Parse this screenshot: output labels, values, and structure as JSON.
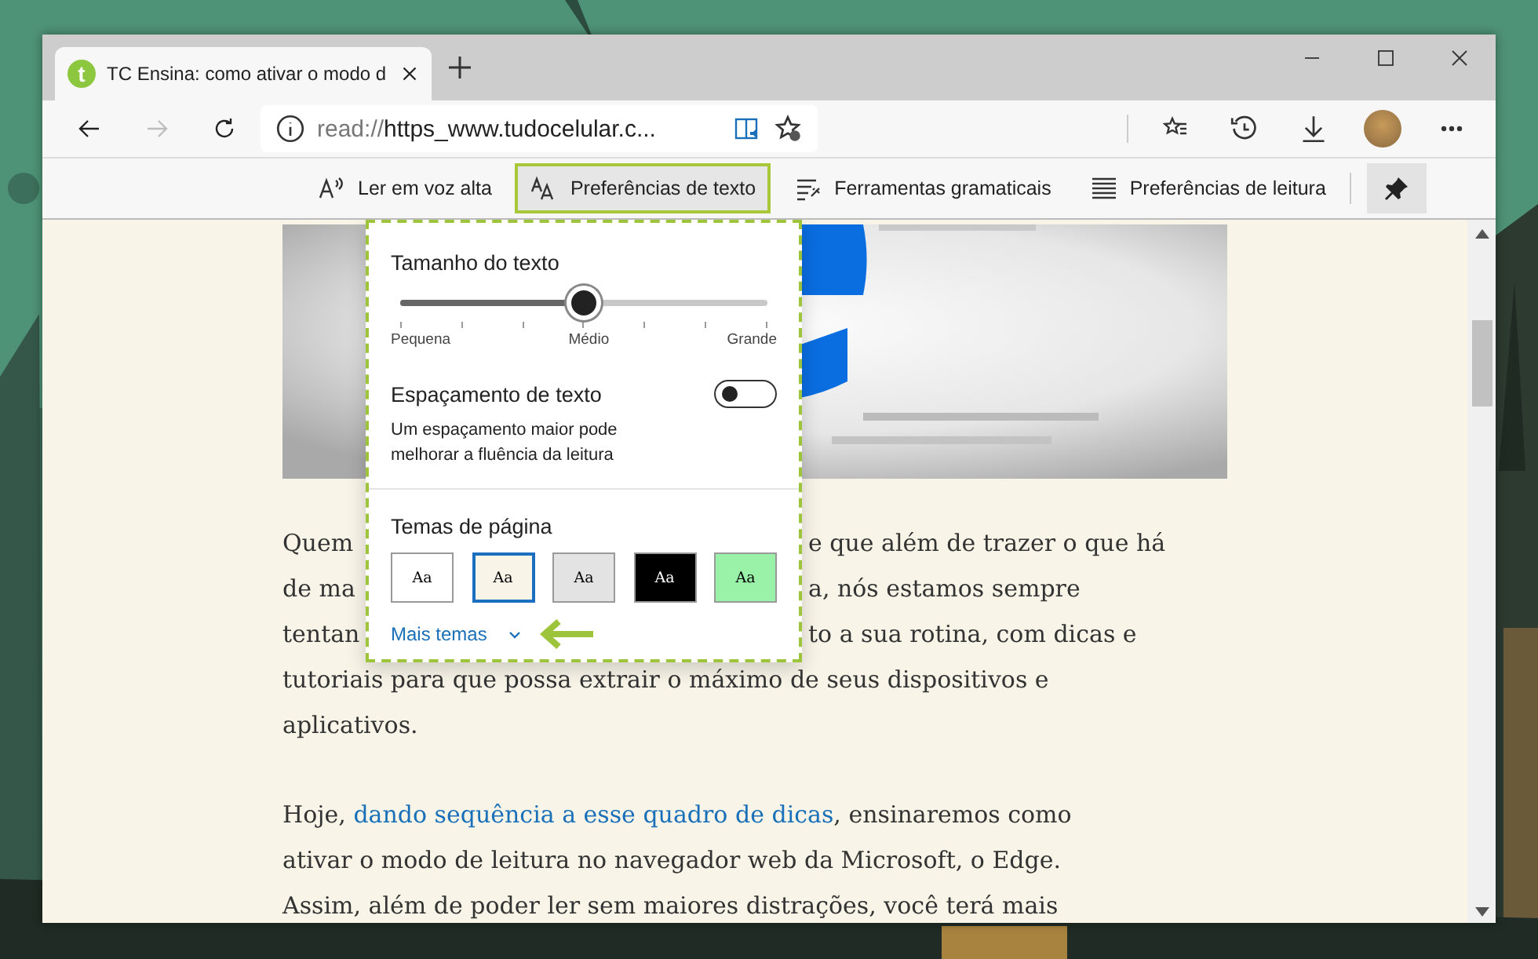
{
  "tabs": [
    {
      "favicon": "t",
      "title": "TC Ensina: como ativar o modo d",
      "selected": true
    }
  ],
  "nav": [
    {
      "kind": "back",
      "disabled": false
    },
    {
      "kind": "forward",
      "disabled": true
    },
    {
      "kind": "refresh",
      "disabled": false
    }
  ],
  "address": {
    "scheme": "read://",
    "rest": "https_www.tudocelular.c..."
  },
  "reader_toolbar": [
    {
      "kind": "read_aloud",
      "label": "Ler em voz alta",
      "selected": false
    },
    {
      "kind": "text_prefs",
      "label": "Preferências de texto",
      "selected": true
    },
    {
      "kind": "grammar",
      "label": "Ferramentas gramaticais",
      "selected": false
    },
    {
      "kind": "reading_prefs",
      "label": "Preferências de leitura",
      "selected": false
    }
  ],
  "text_panel": {
    "size_title": "Tamanho do texto",
    "size": {
      "level": 0.5,
      "labels": [
        "Pequena",
        "Médio",
        "Grande"
      ]
    },
    "spacing_title": "Espaçamento de texto",
    "spacing_on": false,
    "spacing_description": "Um espaçamento maior pode melhorar a fluência da leitura",
    "themes_title": "Temas de página",
    "themes": [
      {
        "label": "Aa",
        "color": "#ffffff",
        "selected": false
      },
      {
        "label": "Aa",
        "color": "#f8f4e8",
        "selected": true
      },
      {
        "label": "Aa",
        "color": "#e3e3e3",
        "selected": false
      },
      {
        "label": "Aa",
        "color": "#000000",
        "selected": false
      },
      {
        "label": "Aa",
        "color": "#99f2a7",
        "selected": false
      }
    ],
    "more_themes": "Mais temas"
  },
  "article": {
    "lines": [
      {
        "left": "Quem",
        "right": "e que além de trazer o que há"
      },
      {
        "left": "de ma",
        "right": "a, nós estamos sempre"
      },
      {
        "left": "tentan",
        "right": "to a sua rotina, com dicas e"
      },
      {
        "left": "tutoriais para que possa extrair o máximo de seus dispositivos e"
      },
      {
        "left": "aplicativos."
      }
    ],
    "paragraph": [
      {
        "kind": "text",
        "text": "Hoje, "
      },
      {
        "kind": "link",
        "text": "dando sequência a esse quadro de dicas"
      },
      {
        "kind": "text",
        "text": ", ensinaremos como"
      },
      {
        "kind": "break"
      },
      {
        "kind": "text",
        "text": "ativar o modo de leitura no navegador web da Microsoft, o Edge."
      },
      {
        "kind": "break"
      },
      {
        "kind": "text",
        "text": "Assim, além de poder ler sem maiores distrações, você terá mais"
      }
    ]
  }
}
